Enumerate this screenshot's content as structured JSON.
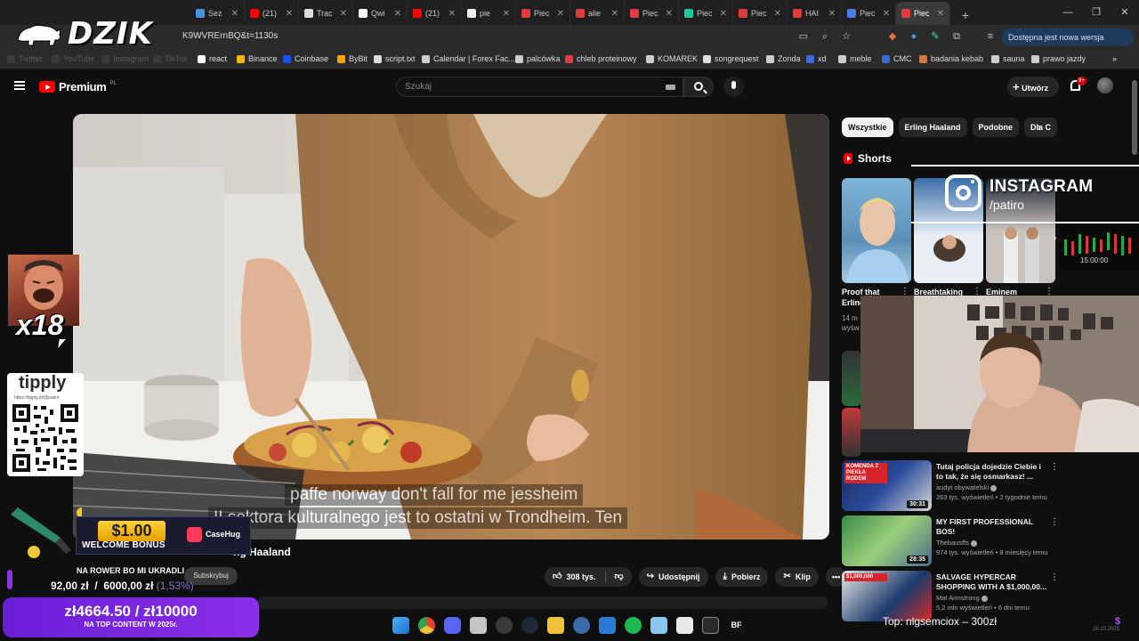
{
  "browser": {
    "tabs": [
      {
        "label": "Sez",
        "color": "#4a90e2"
      },
      {
        "label": "(21)",
        "color": "#ff0000"
      },
      {
        "label": "Trac",
        "color": "#dddddd"
      },
      {
        "label": "Qwi",
        "color": "#ffffff"
      },
      {
        "label": "(21)",
        "color": "#ff0000"
      },
      {
        "label": "pie",
        "color": "#f1f1f1"
      },
      {
        "label": "Piec",
        "color": "#e23b3b"
      },
      {
        "label": "alie",
        "color": "#e23b3b"
      },
      {
        "label": "Piec",
        "color": "#e23b3b"
      },
      {
        "label": "Piec",
        "color": "#1cc8a0"
      },
      {
        "label": "Piec",
        "color": "#e23b3b"
      },
      {
        "label": "HAI",
        "color": "#e23b3b"
      },
      {
        "label": "Piec",
        "color": "#4a7ae2"
      },
      {
        "label": "Piec",
        "color": "#e23b3b"
      }
    ],
    "new_tab": "+",
    "url": "K9WVRErnBQ&t=1130s",
    "update_label": "Dostępna jest nowa wersja Chrome",
    "bookmarks": [
      {
        "label": "Twitter",
        "faded": true
      },
      {
        "label": "YouTube",
        "faded": true
      },
      {
        "label": "Instagram",
        "faded": true
      },
      {
        "label": "TikTok",
        "faded": true
      },
      {
        "label": "react"
      },
      {
        "label": "Binance"
      },
      {
        "label": "Coinbase"
      },
      {
        "label": "ByBit"
      },
      {
        "label": "script.txt"
      },
      {
        "label": "Calendar | Forex Fac..."
      },
      {
        "label": "palcówka"
      },
      {
        "label": "chleb proteinowy"
      },
      {
        "label": "KOMAREK"
      },
      {
        "label": "songrequest"
      },
      {
        "label": "Zonda"
      },
      {
        "label": "xd"
      },
      {
        "label": "meble"
      },
      {
        "label": "CMC"
      },
      {
        "label": "badania kebab"
      },
      {
        "label": "sauna"
      },
      {
        "label": "prawo jazdy"
      }
    ]
  },
  "stream": {
    "logo_text": "DZIK",
    "emote_count": "x18",
    "tipply_name": "tipply",
    "tipply_url": "https://tipply.pl/@patiro",
    "bonus_price": "$1.00",
    "bonus_label": "WELCOME BONUS",
    "casehug": "CaseHug",
    "goal_text": "NA ROWER BO MI UKRADLI",
    "goal_current": "92,00 zł",
    "goal_target": "6000,00 zł",
    "goal_pct": "(1,53%)",
    "donation_main": "zł4664.50 / zł10000",
    "donation_sub": "NA TOP CONTENT W 2025r.",
    "instagram_name": "INSTAGRAM",
    "instagram_handle": "/patiro",
    "chart_time": "15:00:00",
    "top_donation": "Top: nlgsemciox –  300zł",
    "tray_date": "26.10.2025",
    "tray_dollar": "$"
  },
  "youtube": {
    "logo_text": "Premium",
    "logo_sup": "PL",
    "search_placeholder": "Szukaj",
    "create_label": "Utwórz",
    "notif_badge": "9+",
    "subtitle_line1": "paffe norway don't fall for me jessheim",
    "subtitle_line2": "II sektora kulturalnego jest to ostatni w Trondheim. Ten",
    "video_title_fragment": "ng Haaland",
    "subscribe_label": "Subskrybuj",
    "likes": "308 tys.",
    "share": "Udostępnij",
    "download": "Pobierz",
    "clip": "Klip",
    "chips": [
      "Wszystkie",
      "Erling Haaland",
      "Podobne",
      "Dla C"
    ],
    "shorts_heading": "Shorts",
    "shorts": [
      {
        "title": "Proof that",
        "title2": "Erling",
        "meta1": "14 m",
        "meta2": "wyśw"
      },
      {
        "title": "Breathtaking"
      },
      {
        "title": "Eminem"
      }
    ],
    "recs": [
      {
        "title": "Tutaj policja dojedzie Ciebie i to tak, że się osmarkasz! ...",
        "channel": "audyt obywatelski",
        "stats": "263 tys. wyświetleń • 2 tygodnie temu",
        "duration": "30:31",
        "thumb_text": "KOMENDA Z PIEKŁA RODEM"
      },
      {
        "title": "MY FIRST PROFESSIONAL BOS!",
        "channel": "Thebausffs",
        "stats": "974 tys. wyświetleń • 8 miesięcy temu",
        "duration": "28:35",
        "thumb_text": ""
      },
      {
        "title": "SALVAGE HYPERCAR SHOPPING WITH A $1,000,00...",
        "channel": "Mat Armstrong",
        "stats": "5,2 mln wyświetleń • 6 dni temu",
        "duration": "",
        "thumb_text": "$1,000,000"
      }
    ]
  }
}
